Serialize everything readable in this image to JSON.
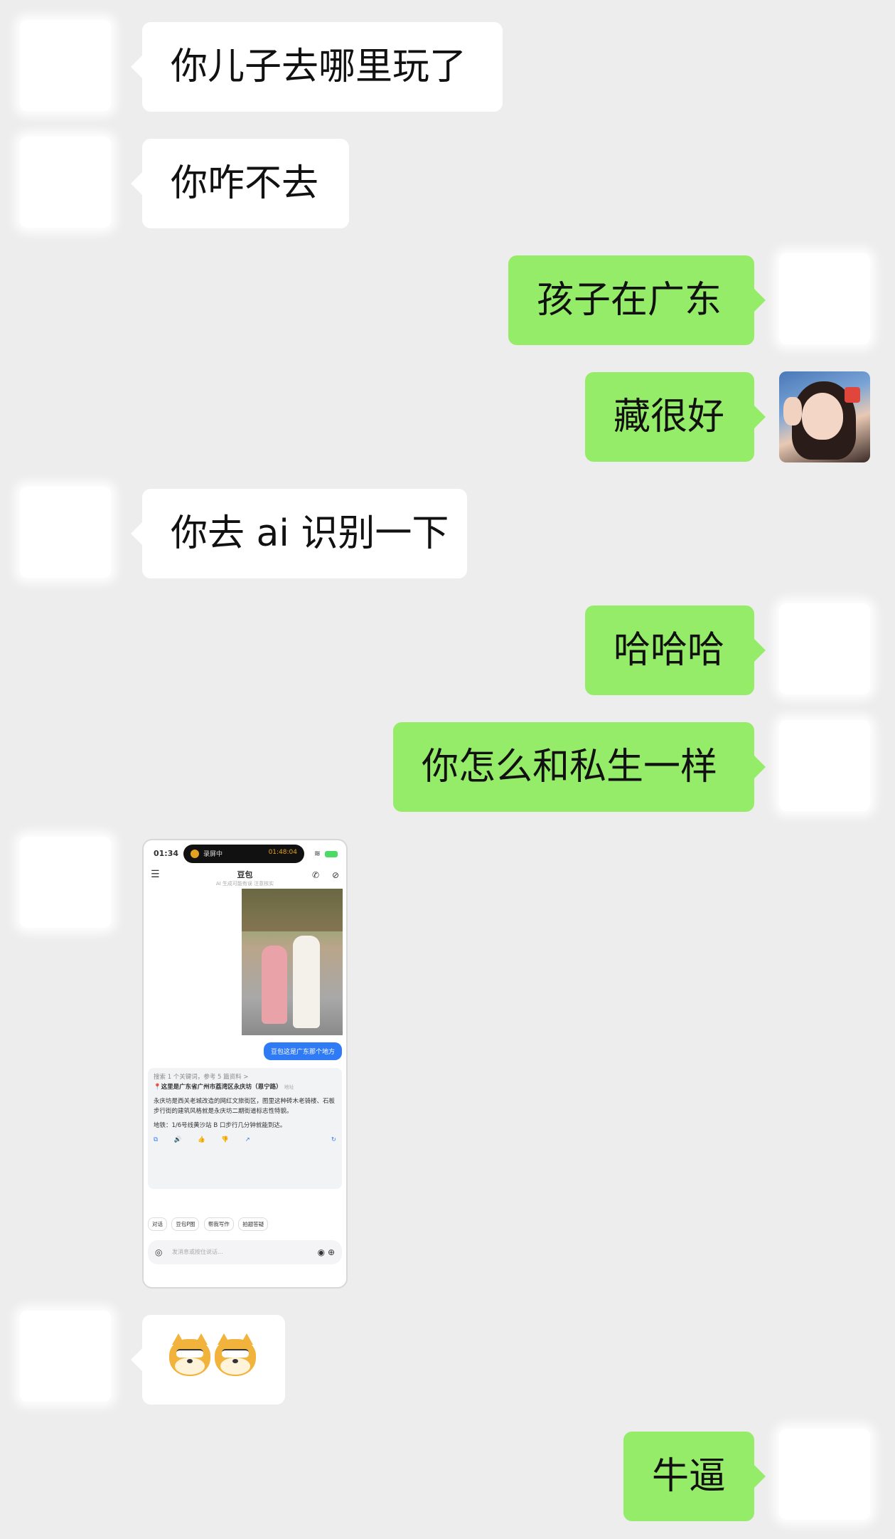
{
  "messages": [
    {
      "side": "in",
      "text": "你儿子去哪里玩了"
    },
    {
      "side": "in",
      "text": "你咋不去"
    },
    {
      "side": "out",
      "text": "孩子在广东"
    },
    {
      "side": "out",
      "text": "藏很好"
    },
    {
      "side": "in",
      "text": "你去 ai 识别一下"
    },
    {
      "side": "out",
      "text": "哈哈哈"
    },
    {
      "side": "out",
      "text": "你怎么和私生一样"
    },
    {
      "side": "out",
      "text": "牛逼"
    }
  ],
  "screenshot": {
    "time": "01:34",
    "recording_label": "录屏中",
    "recording_time": "01:48:04",
    "chat_title": "豆包",
    "chat_subtitle": "AI 生成可能有误 注意核实",
    "question": "豆包这是广东那个地方",
    "search_meta": "搜索 1 个关键词，参考 5 篇资料 >",
    "location": "📍这里是广东省广州市荔湾区永庆坊（恩宁路）",
    "location_tag": "地址",
    "body": "永庆坊是西关老城改造的网红文旅街区，图里这种砖木老骑楼、石板步行街的建筑风格就是永庆坊二期街道标志性特貌。",
    "metro": "地铁：1/6号线黄沙站 B 口步行几分钟就能到达。",
    "action_icons": "⧉ 🔊 👍 👎 ↗",
    "refresh_icon": "↻",
    "chips": [
      "对话",
      "豆包P图",
      "帮我写作",
      "拍题答疑"
    ],
    "input_placeholder": "发消息或按住说话..."
  },
  "emoji": [
    "shiba-dog-emoji",
    "shiba-dog-emoji"
  ]
}
